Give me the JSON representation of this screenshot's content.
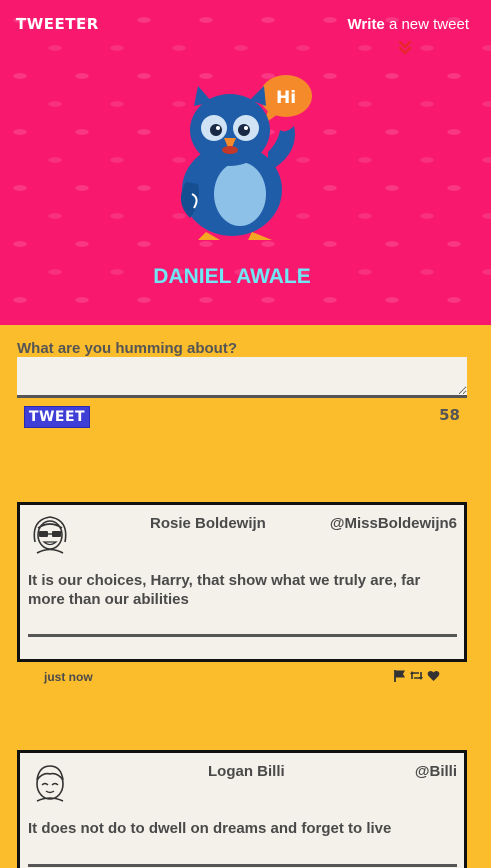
{
  "header": {
    "logo": "TWEETER",
    "write_link": {
      "strong": "Write",
      "rest": " a new tweet"
    },
    "user_name": "DANIEL AWALE",
    "speech_bubble": "Hi",
    "colors": {
      "background": "#f8196f",
      "name": "#6fe7f5"
    }
  },
  "compose": {
    "label": "What are you humming about?",
    "value": "",
    "placeholder": "",
    "button_label": "TWEET",
    "counter": "58",
    "colors": {
      "page": "#fbbd2c",
      "button": "#3f3fd8"
    }
  },
  "tweets": [
    {
      "name": "Rosie Boldewijn",
      "handle": "@MissBoldewijn6",
      "text": "It is our choices, Harry, that show what we truly are, far more than our abilities",
      "time": "just now",
      "avatar_icon": "girl-glasses-avatar-icon",
      "actions": [
        "flag-icon",
        "retweet-icon",
        "heart-icon"
      ]
    },
    {
      "name": "Logan Billi",
      "handle": "@Billi",
      "text": "It does not do to dwell on dreams and forget to live",
      "avatar_icon": "boy-avatar-icon"
    }
  ]
}
